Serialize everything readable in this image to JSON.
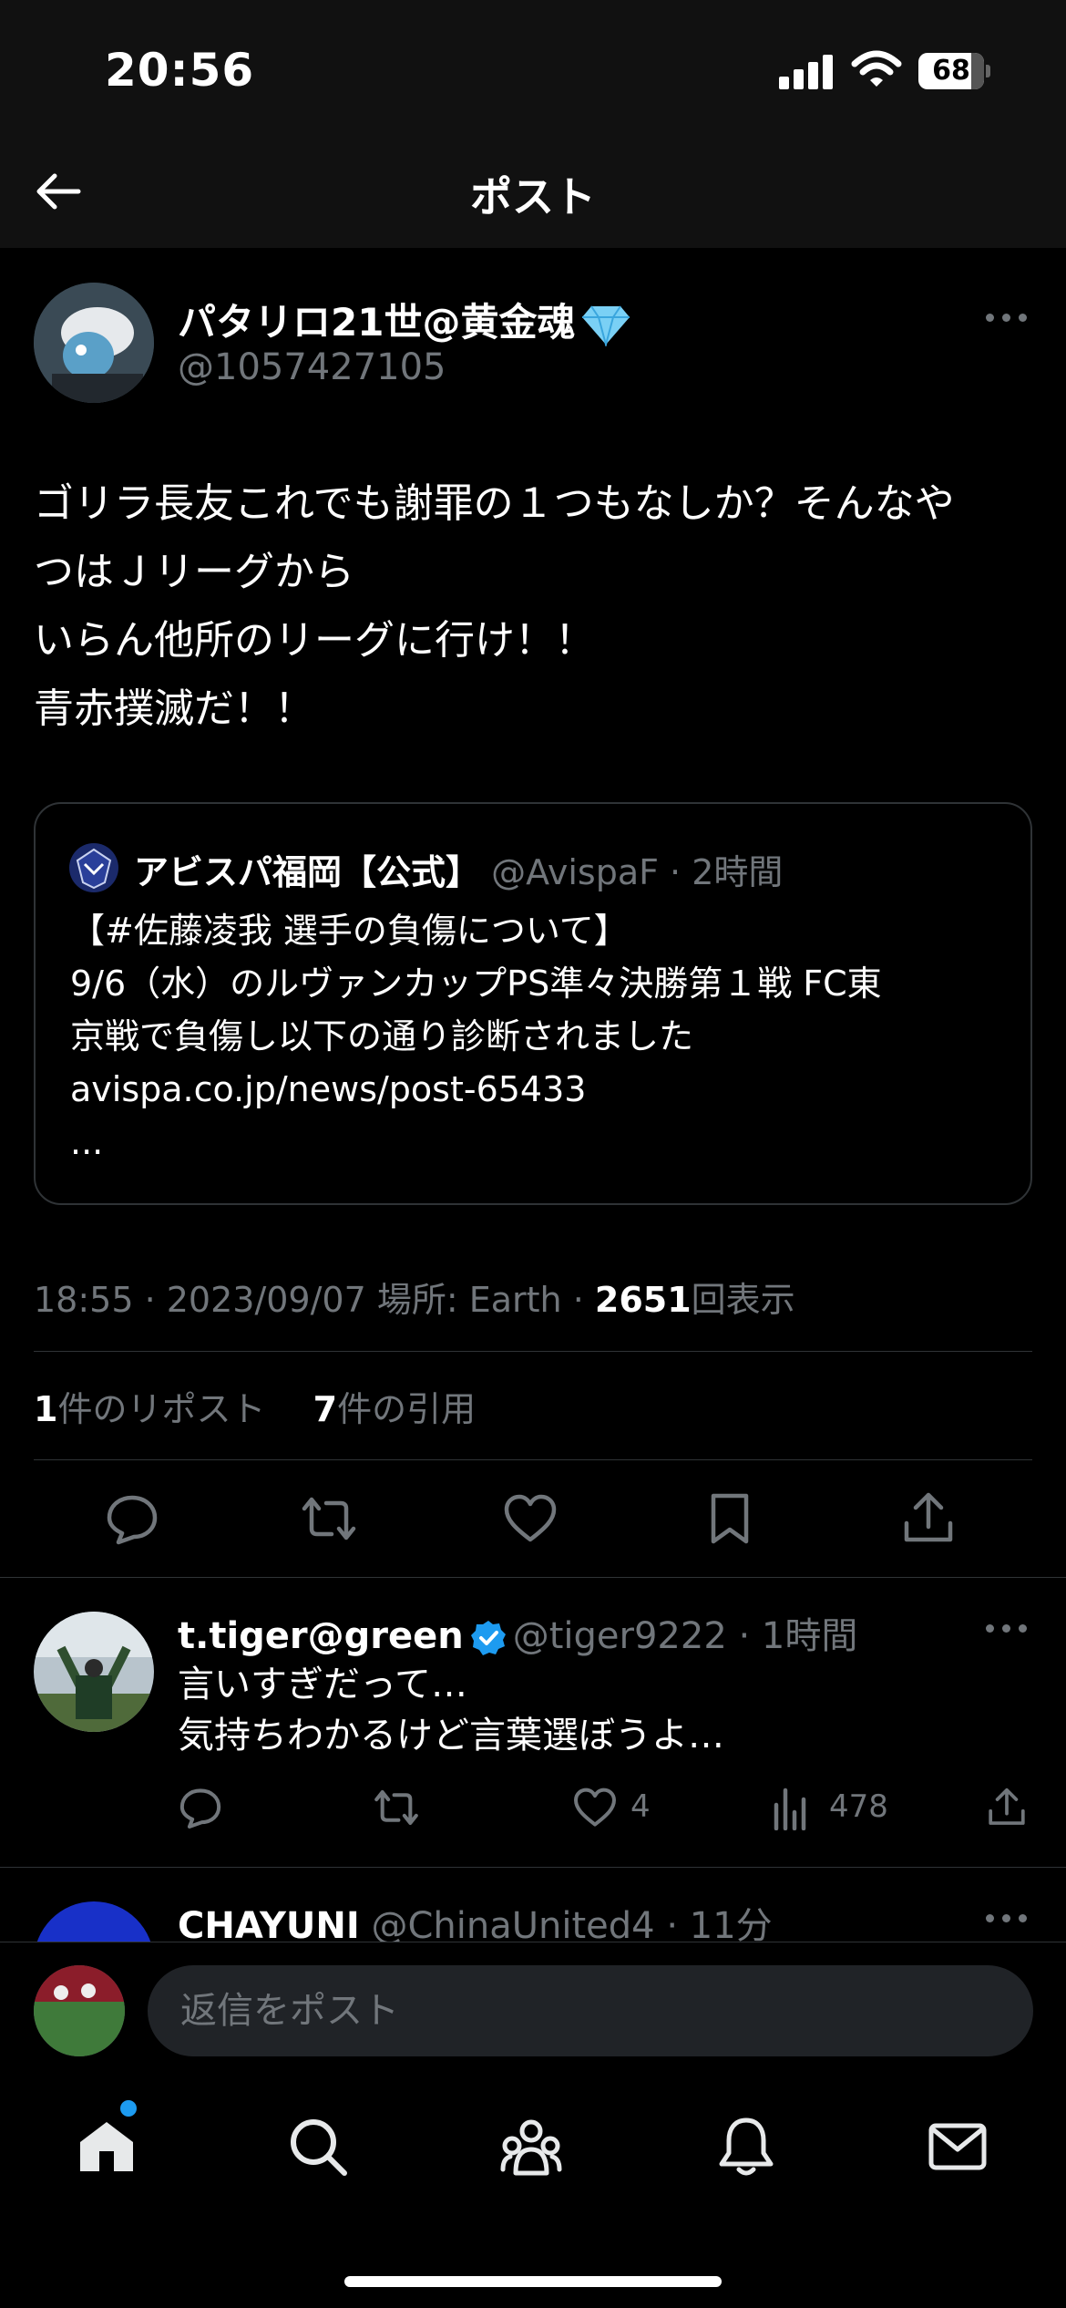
{
  "status_bar": {
    "time": "20:56",
    "battery": "68"
  },
  "header": {
    "title": "ポスト"
  },
  "post": {
    "author_name": "パタリロ21世@黄金魂",
    "author_handle": "@1057427105",
    "text_lines": [
      "ゴリラ長友これでも謝罪の１つもなしか？そんなや",
      "つはＪリーグから",
      "いらん他所のリーグに行け！！",
      "青赤撲滅だ！！"
    ],
    "quote": {
      "name": "アビスパ福岡【公式】",
      "meta": " @AvispaF · 2時間",
      "lines": [
        "【#佐藤凌我 選手の負傷について】",
        "9/6（水）のルヴァンカップPS準々決勝第１戦 FC東",
        "京戦で負傷し以下の通り診断されました",
        "avispa.co.jp/news/post-65433",
        "..."
      ]
    },
    "meta_prefix": "18:55 · 2023/09/07 場所: Earth · ",
    "views_count": "2651",
    "views_label": "回表示",
    "reposts_count": "1",
    "reposts_label": "件のリポスト",
    "quotes_count": "7",
    "quotes_label": "件の引用"
  },
  "replies": [
    {
      "name": "t.tiger@green",
      "meta": "@tiger9222 · 1時間",
      "lines": [
        "言いすぎだって…",
        "気持ちわかるけど言葉選ぼうよ…"
      ],
      "likes": "4",
      "views": "478"
    },
    {
      "name": "CHAYUNI",
      "meta": " @ChinaUnited4 · 11分"
    }
  ],
  "reply_bar": {
    "placeholder": "返信をポスト"
  },
  "colors": {
    "accent": "#1d9bf0",
    "muted": "#71767b",
    "background": "#000000"
  }
}
